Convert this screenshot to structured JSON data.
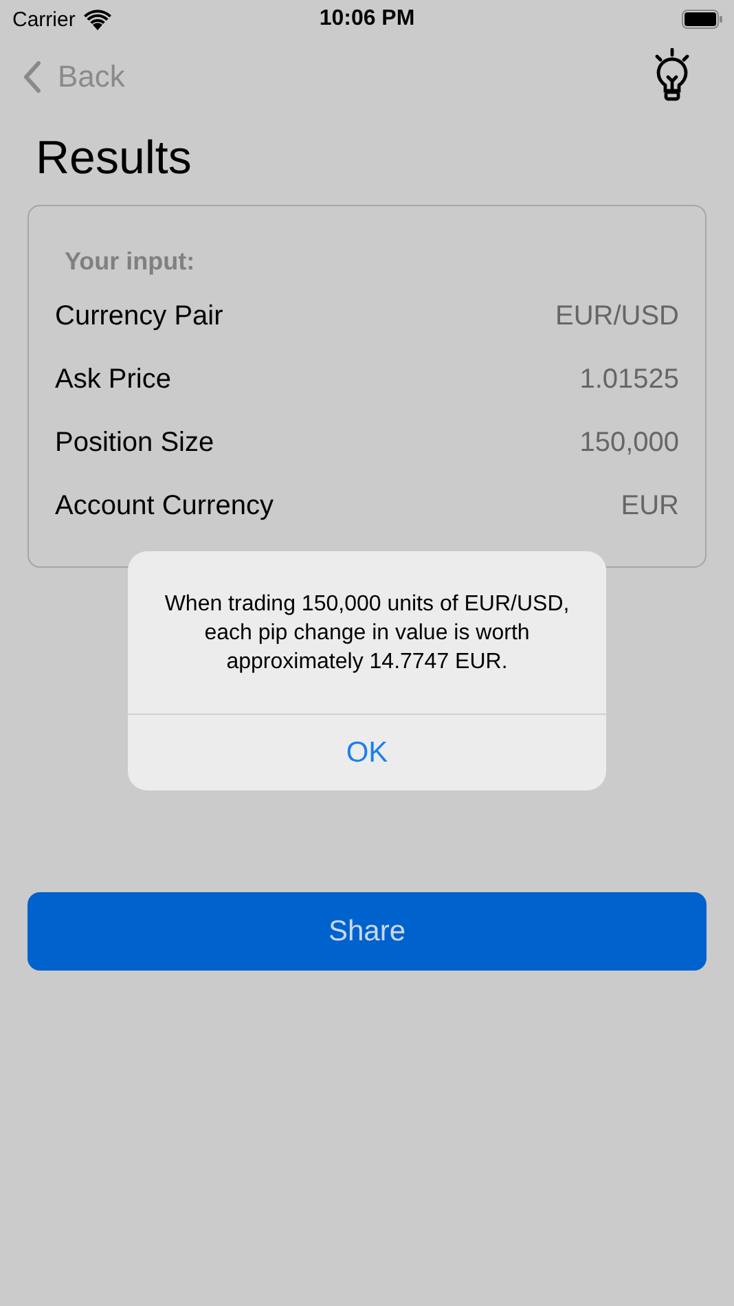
{
  "status_bar": {
    "carrier": "Carrier",
    "time": "10:06 PM"
  },
  "nav": {
    "back": "Back"
  },
  "title": "Results",
  "input_card": {
    "heading": "Your input:",
    "rows": [
      {
        "label": "Currency Pair",
        "value": "EUR/USD"
      },
      {
        "label": "Ask Price",
        "value": "1.01525"
      },
      {
        "label": "Position Size",
        "value": "150,000"
      },
      {
        "label": "Account Currency",
        "value": "EUR"
      }
    ]
  },
  "share_button": "Share",
  "alert": {
    "message": "When trading 150,000 units of EUR/USD, each pip change in value is worth approximately 14.7747 EUR.",
    "button": "OK"
  }
}
